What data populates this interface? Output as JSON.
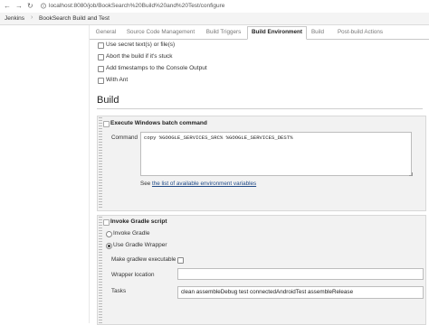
{
  "browser": {
    "url": "localhost:8080/job/BookSearch%20Build%20and%20Test/configure",
    "back_icon": "arrow-left-icon",
    "forward_icon": "arrow-right-icon",
    "reload_icon": "reload-icon"
  },
  "breadcrumbs": [
    {
      "label": "Jenkins"
    },
    {
      "label": "BookSearch Build and Test"
    }
  ],
  "tabs": [
    {
      "label": "General"
    },
    {
      "label": "Source Code Management"
    },
    {
      "label": "Build Triggers"
    },
    {
      "label": "Build Environment",
      "active": true
    },
    {
      "label": "Build"
    },
    {
      "label": "Post-build Actions"
    }
  ],
  "build_environment": {
    "options": [
      {
        "label": "Use secret text(s) or file(s)",
        "checked": false
      },
      {
        "label": "Abort the build if it's stuck",
        "checked": false
      },
      {
        "label": "Add timestamps to the Console Output",
        "checked": false
      },
      {
        "label": "With Ant",
        "checked": false
      }
    ]
  },
  "build": {
    "title": "Build",
    "batch": {
      "title": "Execute Windows batch command",
      "command_label": "Command",
      "command_value": "copy %GOOGLE_SERVICES_SRC% %GOOGLE_SERVICES_DEST%",
      "see_prefix": "See ",
      "see_link": "the list of available environment variables"
    },
    "gradle": {
      "title": "Invoke Gradle script",
      "radio_invoke": "Invoke Gradle",
      "radio_wrapper": "Use Gradle Wrapper",
      "selected": "Use Gradle Wrapper",
      "executable_label": "Make gradlew executable",
      "wrapper_location_label": "Wrapper location",
      "wrapper_location_value": "",
      "tasks_label": "Tasks",
      "tasks_value": "clean assembleDebug test connectedAndroidTest assembleRelease"
    }
  },
  "colors": {
    "link": "#204a87",
    "help_icon": "#2a6ebb",
    "panel_bg": "#f2f2f2"
  }
}
